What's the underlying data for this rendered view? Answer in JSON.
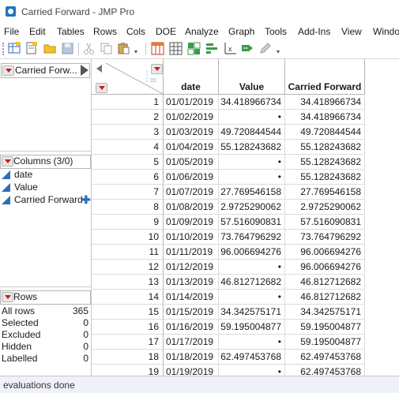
{
  "window": {
    "title": "Carried Forward - JMP Pro"
  },
  "menu": [
    "File",
    "Edit",
    "Tables",
    "Rows",
    "Cols",
    "DOE",
    "Analyze",
    "Graph",
    "Tools",
    "Add-Ins",
    "View",
    "Windo"
  ],
  "toolbar": {
    "icons": [
      "new-data-table-icon",
      "new-script-icon",
      "open-folder-icon",
      "save-icon",
      "cut-icon",
      "copy-icon",
      "paste-icon",
      "data-table-icon",
      "grid-icon",
      "distribution-icon",
      "fit-y-by-x-icon",
      "fit-model-icon",
      "edit-icon"
    ],
    "more": "▾"
  },
  "table_panel": {
    "name": "Carried Forw..."
  },
  "columns_panel": {
    "title": "Columns (3/0)",
    "items": [
      "date",
      "Value",
      "Carried Forward"
    ]
  },
  "rows_panel": {
    "title": "Rows",
    "items": [
      {
        "label": "All rows",
        "value": "365"
      },
      {
        "label": "Selected",
        "value": "0"
      },
      {
        "label": "Excluded",
        "value": "0"
      },
      {
        "label": "Hidden",
        "value": "0"
      },
      {
        "label": "Labelled",
        "value": "0"
      }
    ]
  },
  "grid": {
    "headers": [
      "date",
      "Value",
      "Carried Forward"
    ],
    "rows": [
      [
        "1",
        "01/01/2019",
        "34.418966734",
        "34.418966734"
      ],
      [
        "2",
        "01/02/2019",
        "•",
        "34.418966734"
      ],
      [
        "3",
        "01/03/2019",
        "49.720844544",
        "49.720844544"
      ],
      [
        "4",
        "01/04/2019",
        "55.128243682",
        "55.128243682"
      ],
      [
        "5",
        "01/05/2019",
        "•",
        "55.128243682"
      ],
      [
        "6",
        "01/06/2019",
        "•",
        "55.128243682"
      ],
      [
        "7",
        "01/07/2019",
        "27.769546158",
        "27.769546158"
      ],
      [
        "8",
        "01/08/2019",
        "2.9725290062",
        "2.9725290062"
      ],
      [
        "9",
        "01/09/2019",
        "57.516090831",
        "57.516090831"
      ],
      [
        "10",
        "01/10/2019",
        "73.764796292",
        "73.764796292"
      ],
      [
        "11",
        "01/11/2019",
        "96.006694276",
        "96.006694276"
      ],
      [
        "12",
        "01/12/2019",
        "•",
        "96.006694276"
      ],
      [
        "13",
        "01/13/2019",
        "46.812712682",
        "46.812712682"
      ],
      [
        "14",
        "01/14/2019",
        "•",
        "46.812712682"
      ],
      [
        "15",
        "01/15/2019",
        "34.342575171",
        "34.342575171"
      ],
      [
        "16",
        "01/16/2019",
        "59.195004877",
        "59.195004877"
      ],
      [
        "17",
        "01/17/2019",
        "•",
        "59.195004877"
      ],
      [
        "18",
        "01/18/2019",
        "62.497453768",
        "62.497453768"
      ],
      [
        "19",
        "01/19/2019",
        "•",
        "62.497453768"
      ]
    ]
  },
  "status": {
    "text": "evaluations done"
  }
}
